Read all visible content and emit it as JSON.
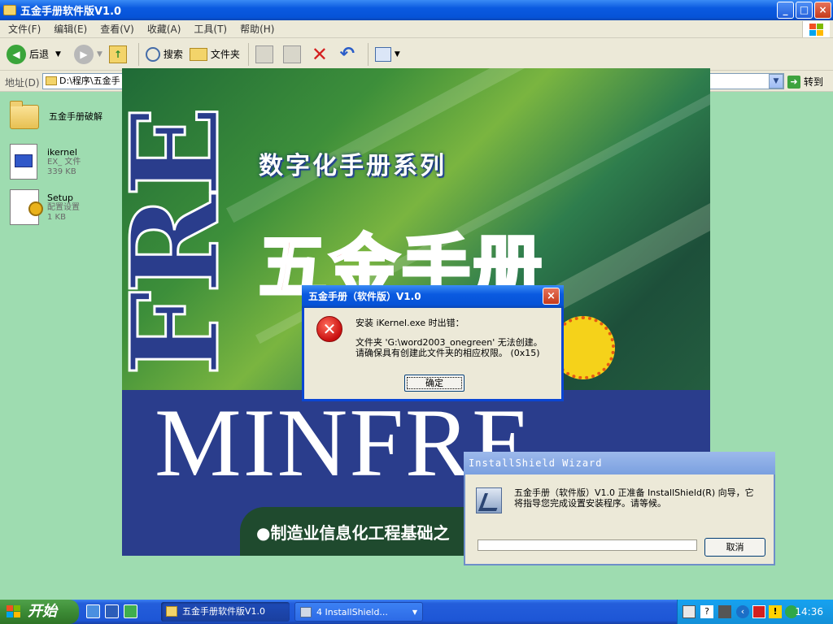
{
  "window": {
    "title": "五金手册软件版V1.0",
    "controls": {
      "minimize": "_",
      "maximize": "□",
      "close": "×"
    }
  },
  "menu": [
    "文件(F)",
    "编辑(E)",
    "查看(V)",
    "收藏(A)",
    "工具(T)",
    "帮助(H)"
  ],
  "toolbar": {
    "back_label": "后退",
    "search_label": "搜索",
    "folders_label": "文件夹"
  },
  "address": {
    "label": "地址(D)",
    "value": "D:\\程序\\五金手",
    "go_label": "转到"
  },
  "files": [
    {
      "name": "五金手册破解",
      "type": "",
      "size": "",
      "icon": "folder-icon"
    },
    {
      "name": "ikernel",
      "type": "EX_ 文件",
      "size": "339 KB",
      "icon": "exe-file-icon"
    },
    {
      "name": "Setup",
      "type": "配置设置",
      "size": "1 KB",
      "icon": "setup-config-icon"
    }
  ],
  "splash": {
    "series": "数字化手册系列",
    "title": "五金手册",
    "brand": "MINFRE",
    "side_letters": "FRE",
    "subtitle": "●制造业信息化工程基础之"
  },
  "error_dialog": {
    "title": "五金手册（软件版）V1.0",
    "line1": "安装 iKernel.exe 时出错：",
    "line2": "文件夹 'G:\\word2003_onegreen' 无法创建。",
    "line3": "请确保具有创建此文件夹的相应权限。 (0x15)",
    "ok_label": "确定"
  },
  "wizard": {
    "title": "InstallShield Wizard",
    "message": "五金手册（软件版）V1.0 正准备 InstallShield(R) 向导，它将指导您完成设置安装程序。请等候。",
    "cancel_label": "取消",
    "progress": 0
  },
  "taskbar": {
    "start_label": "开始",
    "tasks": [
      "五金手册软件版V1.0",
      "4 InstallShield..."
    ],
    "clock": "14:36"
  },
  "colors": {
    "title_blue": "#0a5ae0",
    "desktop_green": "#9edcb0",
    "error_red": "#c80f0f"
  }
}
